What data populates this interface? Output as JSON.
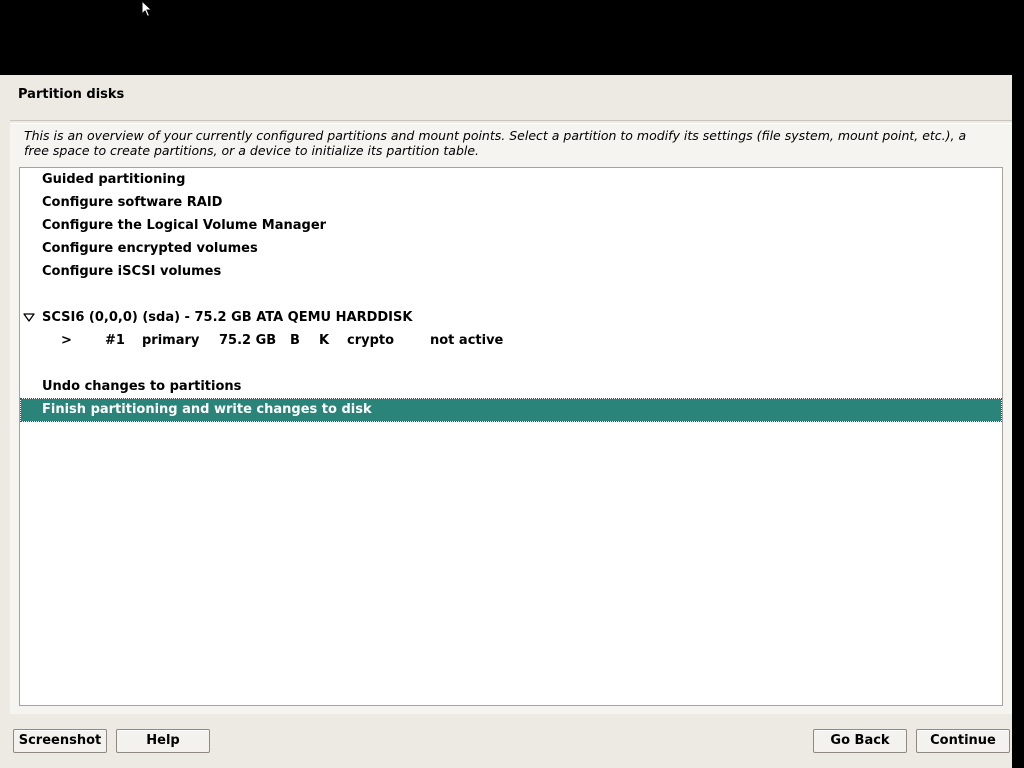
{
  "window": {
    "title": "Partition disks"
  },
  "description": "This is an overview of your currently configured partitions and mount points. Select a partition to modify its settings (file system, mount point, etc.), a free space to create partitions, or a device to initialize its partition table.",
  "menu_items": [
    "Guided partitioning",
    "Configure software RAID",
    "Configure the Logical Volume Manager",
    "Configure encrypted volumes",
    "Configure iSCSI volumes"
  ],
  "disk": {
    "label": "SCSI6 (0,0,0) (sda) - 75.2 GB ATA QEMU HARDDISK",
    "expand_icon": "triangle-down-icon",
    "partition": {
      "marker": ">",
      "number": "#1",
      "type": "primary",
      "size": "75.2 GB",
      "flag_b": "B",
      "flag_k": "K",
      "usage": "crypto",
      "status": "not active"
    }
  },
  "actions": {
    "undo": "Undo changes to partitions",
    "finish": "Finish partitioning and write changes to disk"
  },
  "buttons": {
    "screenshot": "Screenshot",
    "help": "Help",
    "go_back": "Go Back",
    "continue": "Continue"
  },
  "colors": {
    "selection": "#2a8479",
    "window_bg": "#ede9e3",
    "screen_bg": "#000000"
  }
}
